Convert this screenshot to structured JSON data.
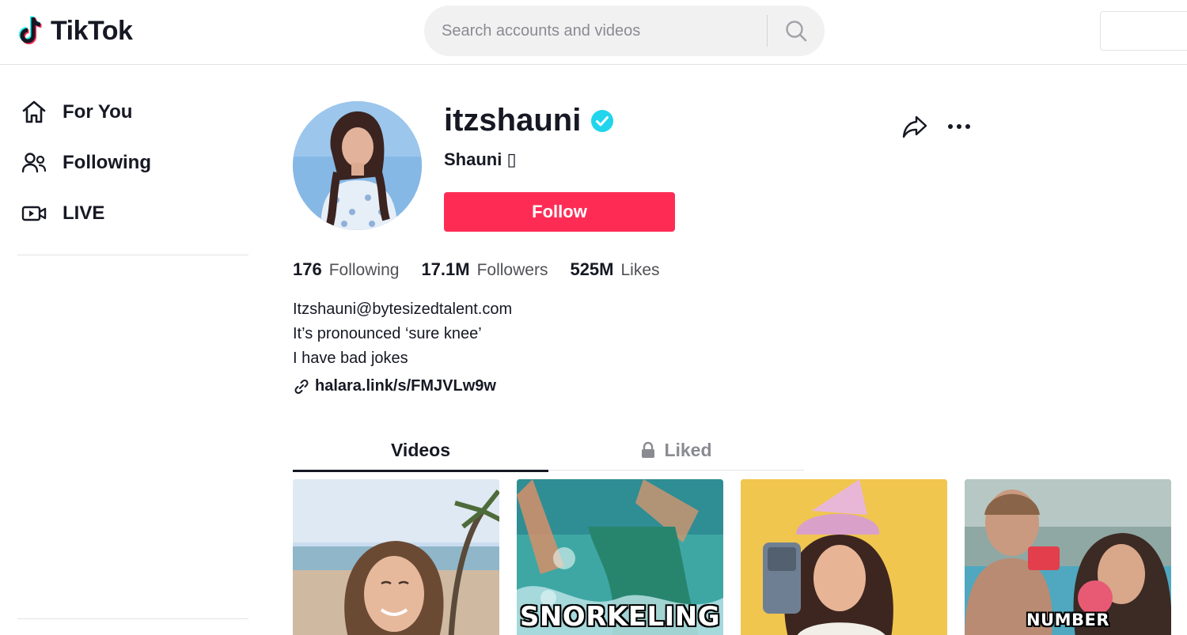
{
  "header": {
    "logo_text": "TikTok",
    "search_placeholder": "Search accounts and videos",
    "search_icon": "search-icon"
  },
  "sidebar": {
    "items": [
      {
        "label": "For You",
        "icon": "home-icon"
      },
      {
        "label": "Following",
        "icon": "people-icon"
      },
      {
        "label": "LIVE",
        "icon": "live-camera-icon"
      }
    ]
  },
  "profile": {
    "username": "itzshauni",
    "verified": true,
    "display_name": "Shauni ▯",
    "follow_label": "Follow",
    "stats": [
      {
        "value": "176",
        "label": "Following"
      },
      {
        "value": "17.1M",
        "label": "Followers"
      },
      {
        "value": "525M",
        "label": "Likes"
      }
    ],
    "bio": [
      "Itzshauni@bytesizedtalent.com",
      "It’s pronounced ‘sure knee’",
      "I have bad jokes"
    ],
    "link": "halara.link/s/FMJVLw9w"
  },
  "tabs": [
    {
      "label": "Videos",
      "active": true
    },
    {
      "label": "Liked",
      "active": false,
      "icon": "lock-icon"
    }
  ],
  "videos": [
    {
      "caption": ""
    },
    {
      "caption": "SNORKELING"
    },
    {
      "caption": ""
    },
    {
      "caption": "NUMBER"
    }
  ],
  "colors": {
    "brand_red": "#fe2c55",
    "verified_blue": "#20d5ec",
    "text": "#161823",
    "muted": "#8a8b91"
  }
}
